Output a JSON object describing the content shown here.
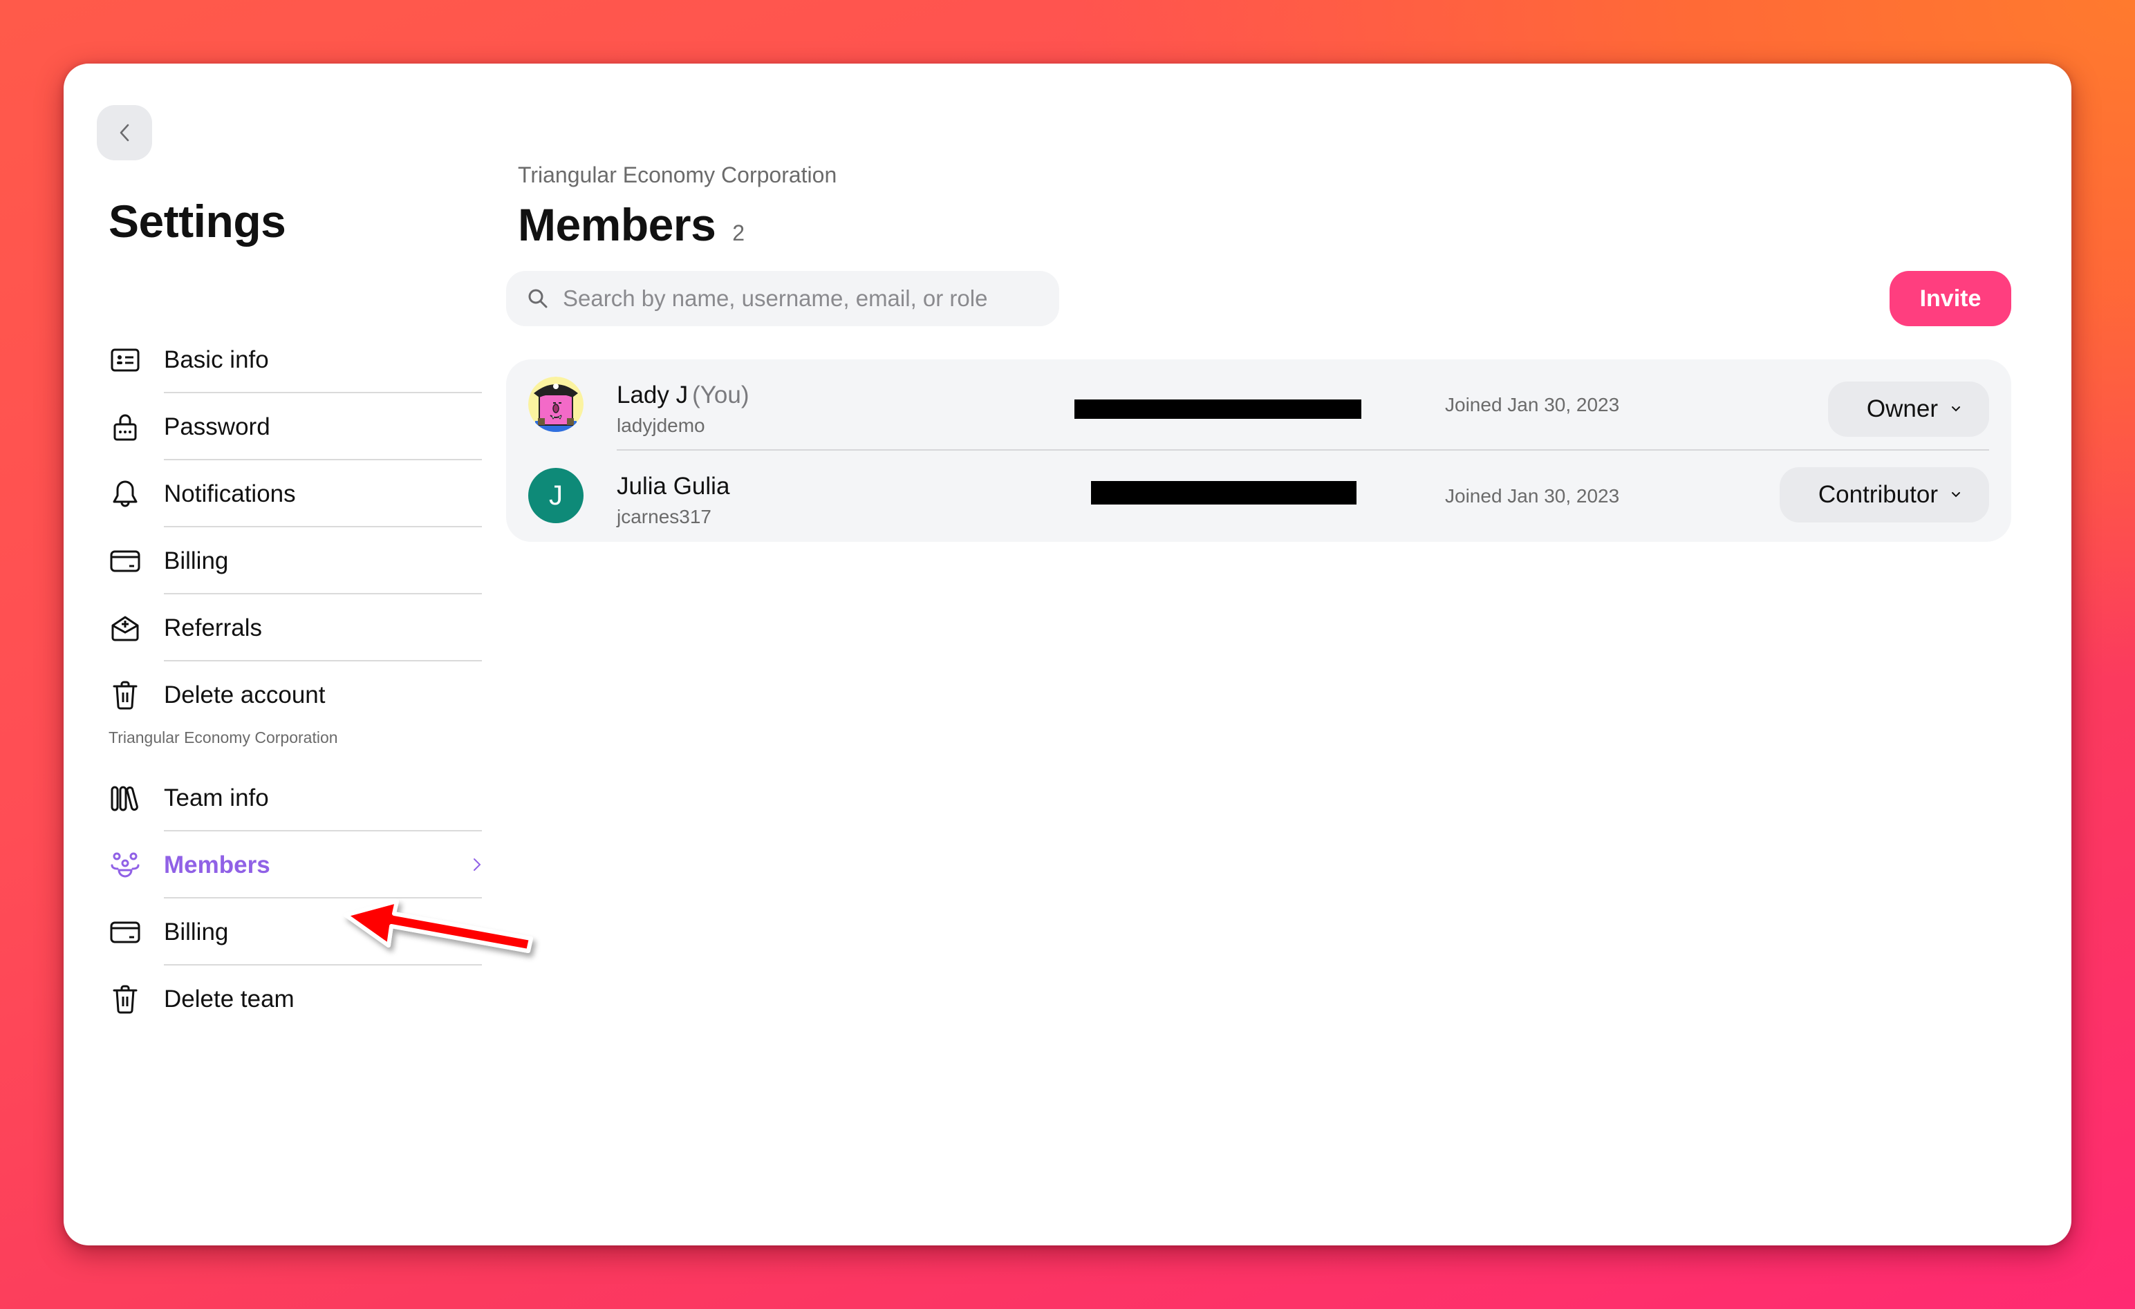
{
  "sidebar": {
    "title": "Settings",
    "back_icon": "chevron-left-icon",
    "personal_items": [
      {
        "label": "Basic info",
        "icon": "id-card-icon"
      },
      {
        "label": "Password",
        "icon": "lock-icon"
      },
      {
        "label": "Notifications",
        "icon": "bell-icon"
      },
      {
        "label": "Billing",
        "icon": "credit-card-icon"
      },
      {
        "label": "Referrals",
        "icon": "envelope-plus-icon"
      },
      {
        "label": "Delete account",
        "icon": "trash-icon"
      }
    ],
    "team_section_label": "Triangular Economy Corporation",
    "team_items": [
      {
        "label": "Team info",
        "icon": "library-icon"
      },
      {
        "label": "Members",
        "icon": "users-group-icon",
        "active": true
      },
      {
        "label": "Billing",
        "icon": "credit-card-icon"
      },
      {
        "label": "Delete team",
        "icon": "trash-icon"
      }
    ]
  },
  "main": {
    "org_name": "Triangular Economy Corporation",
    "title": "Members",
    "count": "2",
    "search": {
      "placeholder": "Search by name, username, email, or role",
      "value": ""
    },
    "invite_label": "Invite",
    "members": [
      {
        "name": "Lady J",
        "you_tag": "(You)",
        "username": "ladyjdemo",
        "avatar": "pirate-avatar",
        "email_redacted": true,
        "joined": "Joined Jan 30, 2023",
        "role": "Owner"
      },
      {
        "name": "Julia Gulia",
        "you_tag": "",
        "username": "jcarnes317",
        "avatar_initial": "J",
        "avatar_color": "#0e8a78",
        "email_redacted": true,
        "joined": "Joined Jan 30, 2023",
        "role": "Contributor"
      }
    ]
  },
  "colors": {
    "accent_purple": "#9061e6",
    "invite_pink": "#ff3e7f",
    "annotation_red": "#ff0000"
  },
  "annotation": {
    "type": "red-arrow",
    "points_to": "Members"
  }
}
